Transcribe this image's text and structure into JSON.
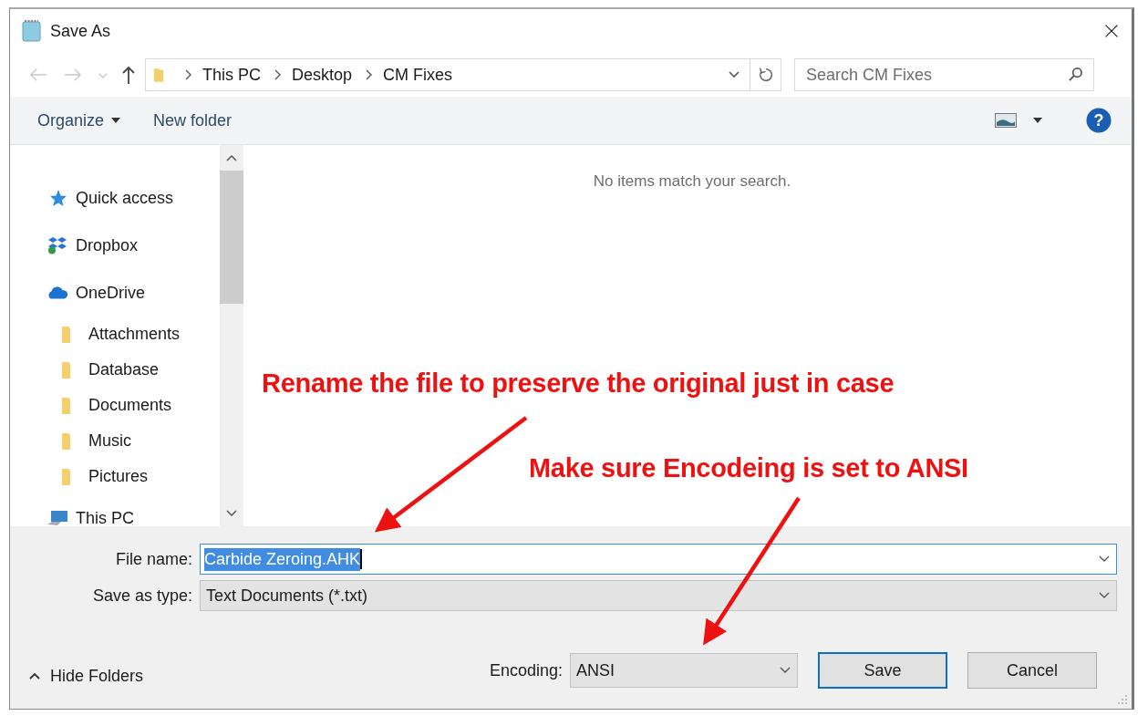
{
  "window": {
    "title": "Save As"
  },
  "nav": {
    "path": [
      "This PC",
      "Desktop",
      "CM Fixes"
    ],
    "search_placeholder": "Search CM Fixes"
  },
  "toolbar": {
    "items": [
      "Organize",
      "New folder"
    ],
    "help": "?"
  },
  "sidebar": {
    "items": [
      {
        "label": "Quick access",
        "kind": "star"
      },
      {
        "label": "Dropbox",
        "kind": "dropbox"
      },
      {
        "label": "OneDrive",
        "kind": "cloud",
        "children": [
          {
            "label": "Attachments",
            "kind": "folder"
          },
          {
            "label": "Database",
            "kind": "folder"
          },
          {
            "label": "Documents",
            "kind": "folder"
          },
          {
            "label": "Music",
            "kind": "folder"
          },
          {
            "label": "Pictures",
            "kind": "folder"
          }
        ]
      },
      {
        "label": "This PC",
        "kind": "pc"
      }
    ]
  },
  "content": {
    "message": "No items match your search."
  },
  "form": {
    "file_name_label": "File name:",
    "file_name": "Carbide Zeroing.AHK",
    "type_label": "Save as type:",
    "type": "Text Documents (*.txt)"
  },
  "footer": {
    "hide_folders": "Hide Folders",
    "encoding_label": "Encoding:",
    "encoding": "ANSI",
    "buttons": [
      {
        "label": "Save",
        "default": true
      },
      {
        "label": "Cancel",
        "default": false
      }
    ]
  },
  "annotations": [
    {
      "text": "Rename the file to preserve the original just in case"
    },
    {
      "text": "Make sure Encodeing is set to ANSI"
    }
  ]
}
